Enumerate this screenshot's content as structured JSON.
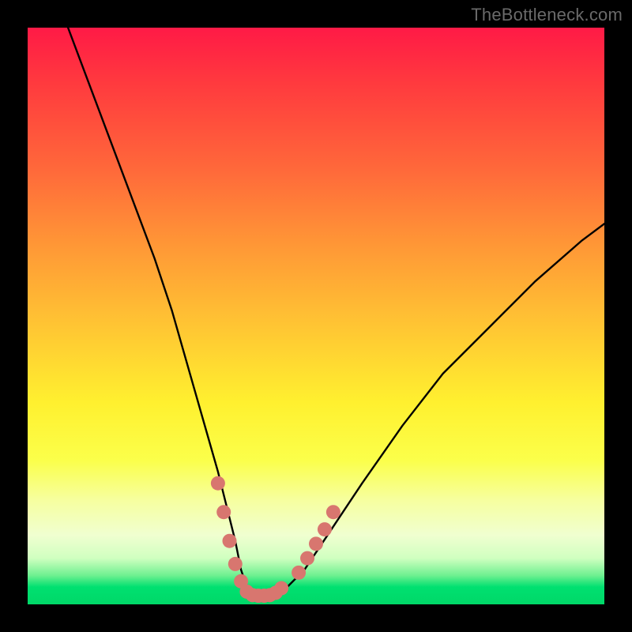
{
  "watermark": "TheBottleneck.com",
  "chart_data": {
    "type": "line",
    "title": "",
    "xlabel": "",
    "ylabel": "",
    "xlim": [
      0,
      100
    ],
    "ylim": [
      0,
      100
    ],
    "grid": false,
    "series": [
      {
        "name": "bottleneck-curve",
        "x": [
          7,
          10,
          13,
          16,
          19,
          22,
          25,
          27,
          29,
          31,
          33,
          34.5,
          36,
          37,
          38,
          39.5,
          41,
          43,
          45,
          48,
          52,
          58,
          65,
          72,
          80,
          88,
          96,
          100
        ],
        "y": [
          100,
          92,
          84,
          76,
          68,
          60,
          51,
          44,
          37,
          30,
          23,
          17,
          11,
          6,
          3,
          1.5,
          1.5,
          1.8,
          3,
          6,
          12,
          21,
          31,
          40,
          48,
          56,
          63,
          66
        ]
      }
    ],
    "markers": [
      {
        "name": "highlight-dots",
        "color": "#d8766f",
        "points": [
          {
            "x": 33.0,
            "y": 21
          },
          {
            "x": 34.0,
            "y": 16
          },
          {
            "x": 35.0,
            "y": 11
          },
          {
            "x": 36.0,
            "y": 7
          },
          {
            "x": 37.0,
            "y": 4
          },
          {
            "x": 38.0,
            "y": 2.2
          },
          {
            "x": 39.0,
            "y": 1.6
          },
          {
            "x": 40.0,
            "y": 1.5
          },
          {
            "x": 41.0,
            "y": 1.5
          },
          {
            "x": 42.0,
            "y": 1.6
          },
          {
            "x": 43.0,
            "y": 2.0
          },
          {
            "x": 44.0,
            "y": 2.8
          },
          {
            "x": 47.0,
            "y": 5.5
          },
          {
            "x": 48.5,
            "y": 8
          },
          {
            "x": 50.0,
            "y": 10.5
          },
          {
            "x": 51.5,
            "y": 13
          },
          {
            "x": 53.0,
            "y": 16
          }
        ]
      }
    ]
  }
}
